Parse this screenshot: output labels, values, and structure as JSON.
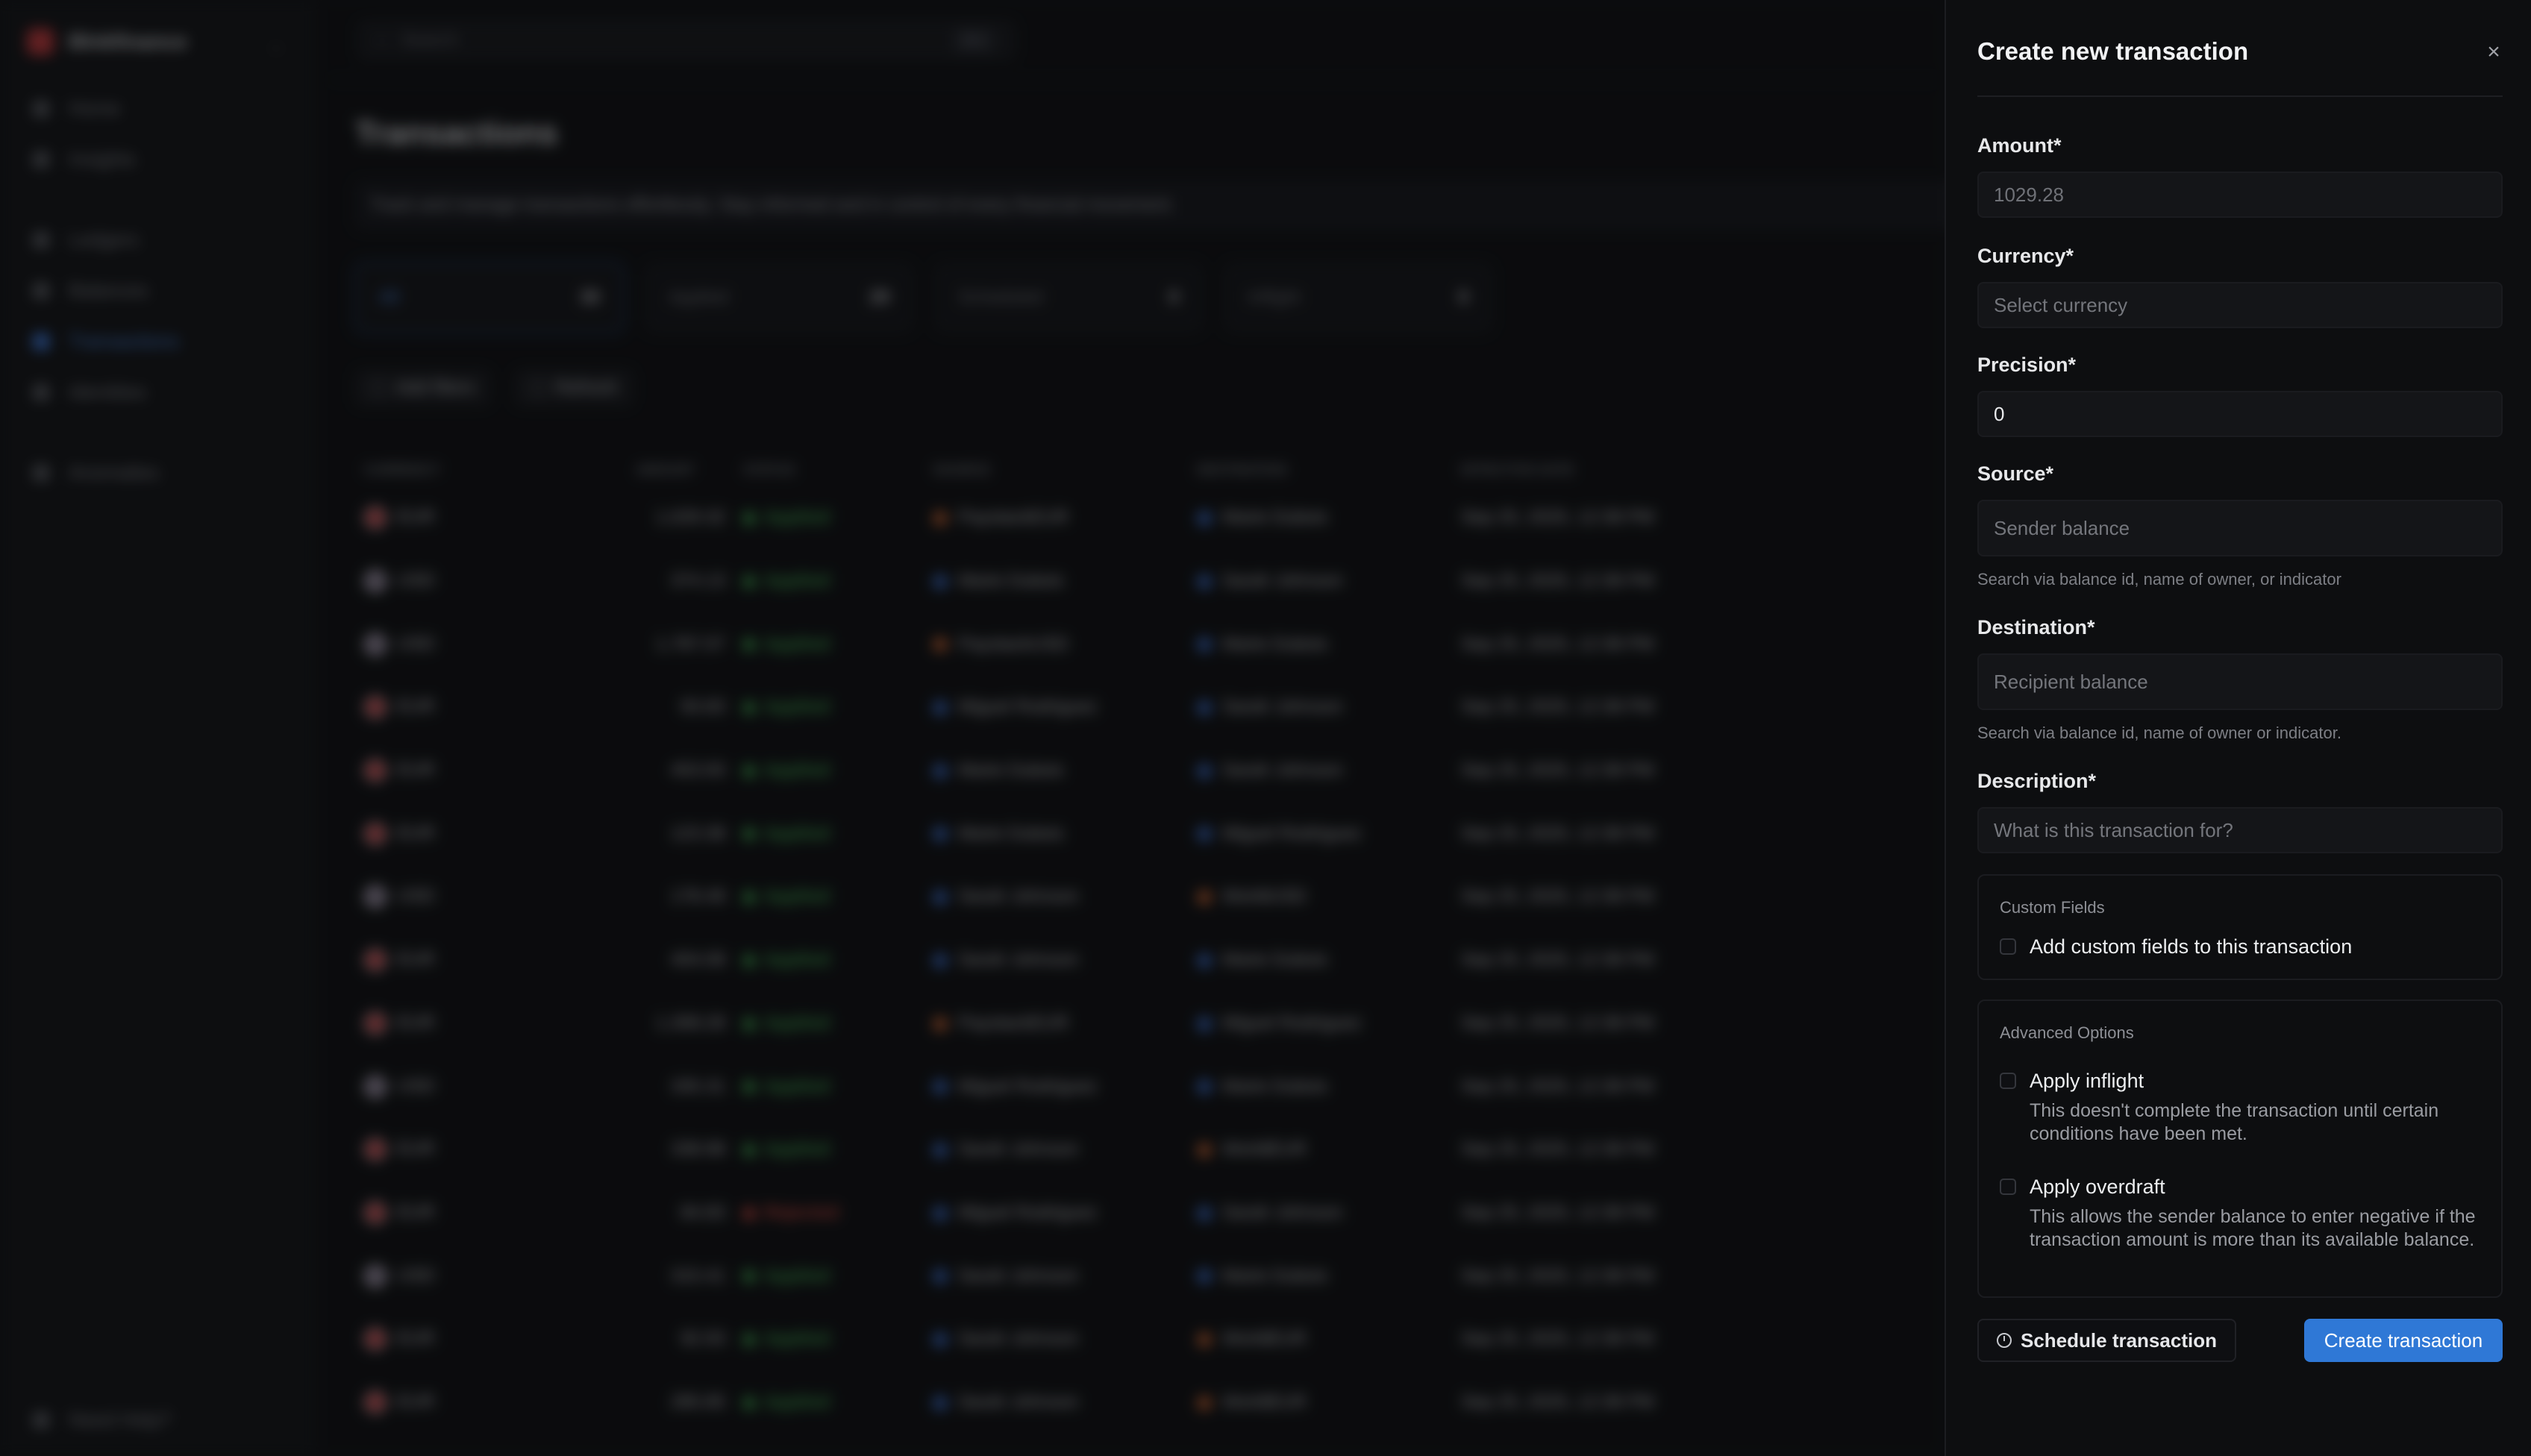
{
  "sidebar": {
    "brand": "Blnkfinance",
    "items": [
      {
        "label": "Home",
        "top": 0
      },
      {
        "label": "Insights"
      },
      {
        "label": "Ledgers"
      },
      {
        "label": "Balances"
      },
      {
        "label": "Transactions"
      },
      {
        "label": "Identities"
      },
      {
        "label": "Anomalies"
      }
    ],
    "help": "Need Help?"
  },
  "header": {
    "search_placeholder": "Search",
    "search_shortcut": "⌘K"
  },
  "page": {
    "title": "Transactions",
    "description": "Track and manage transactions effortlessly. Stay informed and in control of every financial movement."
  },
  "stats": [
    {
      "label": "All",
      "count": "30"
    },
    {
      "label": "Applied",
      "count": "29"
    },
    {
      "label": "Scheduled",
      "count": "0"
    },
    {
      "label": "Inflight",
      "count": "0"
    }
  ],
  "chips": {
    "filters": "Add filters",
    "refresh": "Refresh"
  },
  "table": {
    "headers": [
      "CURRENCY",
      "AMOUNT",
      "STATUS",
      "SOURCE",
      "DESTINATION",
      "EFFECTIVE DATE"
    ],
    "rows": [
      {
        "currency": "EUR",
        "amount": "1,029.32",
        "status": "Applied",
        "source": "PaystackEUR",
        "destination": "Marie Dubois",
        "date": "Sep 25, 2025, 12:38 PM"
      },
      {
        "currency": "USD",
        "amount": "374.13",
        "status": "Applied",
        "source": "Marie Dubois",
        "destination": "Sarah Johnson",
        "date": "Sep 25, 2025, 12:38 PM"
      },
      {
        "currency": "USD",
        "amount": "1,787.07",
        "status": "Applied",
        "source": "PaystackUSD",
        "destination": "Marie Dubois",
        "date": "Sep 25, 2025, 12:38 PM"
      },
      {
        "currency": "EUR",
        "amount": "93.83",
        "status": "Applied",
        "source": "Miguel Rodriguez",
        "destination": "Sarah Johnson",
        "date": "Sep 25, 2025, 12:38 PM"
      },
      {
        "currency": "EUR",
        "amount": "453.93",
        "status": "Applied",
        "source": "Marie Dubois",
        "destination": "Sarah Johnson",
        "date": "Sep 25, 2025, 12:38 PM"
      },
      {
        "currency": "EUR",
        "amount": "123.38",
        "status": "Applied",
        "source": "Marie Dubois",
        "destination": "Miguel Rodriguez",
        "date": "Sep 25, 2025, 12:38 PM"
      },
      {
        "currency": "USD",
        "amount": "178.49",
        "status": "Applied",
        "source": "Sarah Johnson",
        "destination": "WorldUSD",
        "date": "Sep 25, 2025, 12:38 PM"
      },
      {
        "currency": "EUR",
        "amount": "404.08",
        "status": "Applied",
        "source": "Sarah Johnson",
        "destination": "Marie Dubois",
        "date": "Sep 25, 2025, 12:38 PM"
      },
      {
        "currency": "EUR",
        "amount": "1,308.28",
        "status": "Applied",
        "source": "PaystackEUR",
        "destination": "Miguel Rodriguez",
        "date": "Sep 25, 2025, 12:38 PM"
      },
      {
        "currency": "USD",
        "amount": "335.31",
        "status": "Applied",
        "source": "Miguel Rodriguez",
        "destination": "Marie Dubois",
        "date": "Sep 25, 2025, 12:38 PM"
      },
      {
        "currency": "EUR",
        "amount": "338.98",
        "status": "Applied",
        "source": "Sarah Johnson",
        "destination": "WorldEUR",
        "date": "Sep 25, 2025, 12:38 PM"
      },
      {
        "currency": "EUR",
        "amount": "84.83",
        "status": "Rejected",
        "source": "Miguel Rodriguez",
        "destination": "Sarah Johnson",
        "date": "Sep 25, 2025, 12:38 PM"
      },
      {
        "currency": "USD",
        "amount": "315.41",
        "status": "Applied",
        "source": "Sarah Johnson",
        "destination": "Marie Dubois",
        "date": "Sep 25, 2025, 12:38 PM"
      },
      {
        "currency": "EUR",
        "amount": "92.93",
        "status": "Applied",
        "source": "Sarah Johnson",
        "destination": "WorldEUR",
        "date": "Sep 25, 2025, 12:38 PM"
      },
      {
        "currency": "EUR",
        "amount": "285.85",
        "status": "Applied",
        "source": "Sarah Johnson",
        "destination": "WorldEUR",
        "date": "Sep 25, 2025, 12:38 PM"
      }
    ]
  },
  "panel": {
    "title": "Create new transaction",
    "amount": {
      "label": "Amount*",
      "value": "1029.28"
    },
    "currency": {
      "label": "Currency*",
      "placeholder": "Select currency"
    },
    "precision": {
      "label": "Precision*",
      "value": "0"
    },
    "source": {
      "label": "Source*",
      "placeholder": "Sender balance",
      "hint": "Search via balance id, name of owner, or indicator"
    },
    "destination": {
      "label": "Destination*",
      "placeholder": "Recipient balance",
      "hint": "Search via balance id, name of owner or indicator."
    },
    "description": {
      "label": "Description*",
      "placeholder": "What is this transaction for?"
    },
    "custom_fields": {
      "title": "Custom Fields",
      "checkbox_label": "Add custom fields to this transaction"
    },
    "advanced": {
      "title": "Advanced Options",
      "inflight": {
        "label": "Apply inflight",
        "desc": "This doesn't complete the transaction until certain conditions have been met."
      },
      "overdraft": {
        "label": "Apply overdraft",
        "desc": "This allows the sender balance to enter negative if the transaction amount is more than its available balance."
      }
    },
    "schedule_button": "Schedule transaction",
    "create_button": "Create transaction",
    "primary_color": "#2f78d6"
  }
}
